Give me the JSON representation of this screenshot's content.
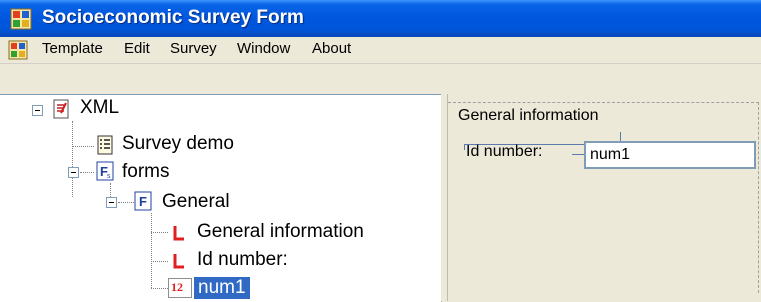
{
  "window": {
    "title": "Socioeconomic Survey Form",
    "accent": "#0055d8"
  },
  "menu": {
    "items": [
      "Template",
      "Edit",
      "Survey",
      "Window",
      "About"
    ]
  },
  "tree": {
    "root": {
      "label": "XML",
      "icon": "xml-file-icon"
    },
    "survey": {
      "label": "Survey demo",
      "icon": "survey-icon"
    },
    "forms": {
      "label": "forms",
      "icon": "forms-icon"
    },
    "general": {
      "label": "General",
      "icon": "form-icon"
    },
    "label_general_info": {
      "label": "General information",
      "icon": "label-icon"
    },
    "label_id": {
      "label": "Id number:",
      "icon": "label-icon"
    },
    "num1": {
      "label": "num1",
      "icon": "number-field-icon",
      "badge": "12",
      "selected": true
    }
  },
  "preview": {
    "group_label": "General information",
    "field_label": "Id number:",
    "field_value": "num1"
  }
}
